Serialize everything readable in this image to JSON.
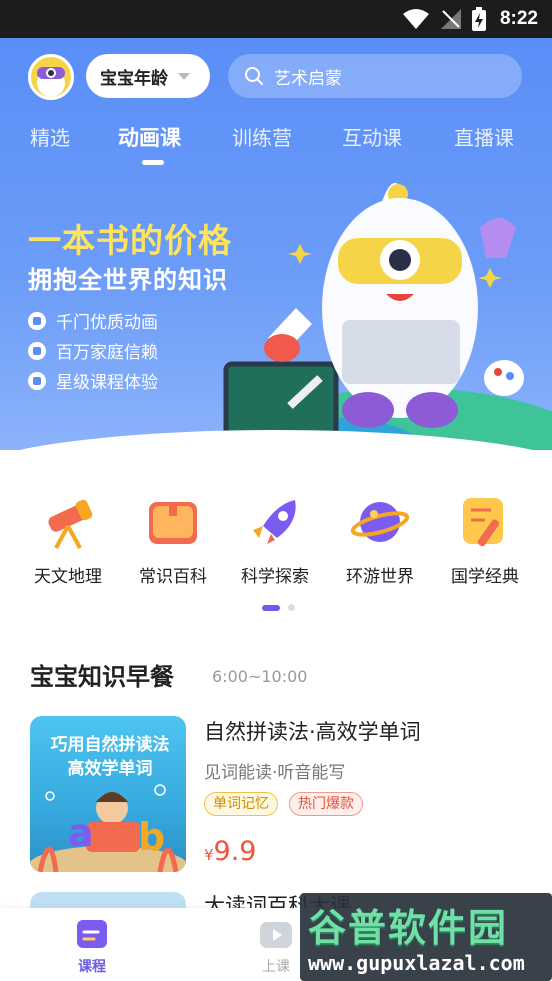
{
  "status_bar": {
    "time": "8:22"
  },
  "header": {
    "age_selector": "宝宝年龄",
    "search_placeholder": "艺术启蒙"
  },
  "tabs": [
    {
      "label": "精选",
      "active": false
    },
    {
      "label": "动画课",
      "active": true
    },
    {
      "label": "训练营",
      "active": false
    },
    {
      "label": "互动课",
      "active": false
    },
    {
      "label": "直播课",
      "active": false
    }
  ],
  "banner": {
    "headline": "一本书的价格",
    "subheadline": "拥抱全世界的知识",
    "features": [
      "千门优质动画",
      "百万家庭信赖",
      "星级课程体验"
    ]
  },
  "categories": [
    {
      "label": "天文地理",
      "icon": "telescope-icon"
    },
    {
      "label": "常识百科",
      "icon": "book-icon"
    },
    {
      "label": "科学探索",
      "icon": "rocket-icon"
    },
    {
      "label": "环游世界",
      "icon": "planet-icon"
    },
    {
      "label": "国学经典",
      "icon": "brush-icon"
    }
  ],
  "section": {
    "title": "宝宝知识早餐",
    "time": "6:00~10:00"
  },
  "course": {
    "thumb_line1": "巧用自然拼读法",
    "thumb_line2": "高效学单词",
    "title": "自然拼读法·高效学单词",
    "subtitle": "见词能读·听音能写",
    "tags": [
      "单词记忆",
      "热门爆款"
    ],
    "currency": "¥",
    "price": "9.9"
  },
  "next_course": {
    "title": "大读词百科大课"
  },
  "bottom_nav": [
    {
      "label": "课程",
      "active": true
    },
    {
      "label": "上课",
      "active": false
    }
  ],
  "watermark": {
    "brand": "谷普软件园",
    "url": "www.gupuxlazal.com"
  },
  "colors": {
    "primary_blue": "#5a8ef7",
    "accent_purple": "#6c5ce7",
    "headline_yellow": "#ffe35a",
    "price_red": "#f0553b"
  }
}
